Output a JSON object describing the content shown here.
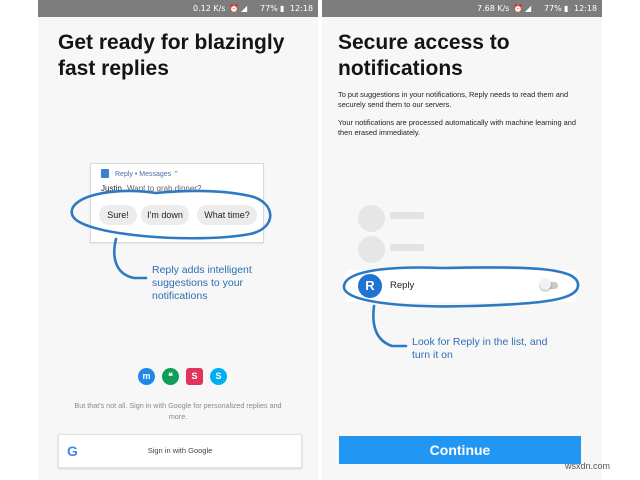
{
  "screen1": {
    "status": {
      "speed": "0.12 K/s",
      "battery": "77%",
      "time": "12:18"
    },
    "title": "Get ready for blazingly fast replies",
    "notification": {
      "app_label": "Reply • Messages ⌃",
      "sender": "Justin",
      "message": "Want to grab dinner?"
    },
    "suggestions": [
      "Sure!",
      "I'm down",
      "What time?"
    ],
    "caption": "Reply adds intelligent suggestions to your notifications",
    "apps": [
      {
        "name": "messenger-icon",
        "glyph": "m",
        "color": "#1e88e5"
      },
      {
        "name": "hangouts-icon",
        "glyph": "❝",
        "color": "#0f9d58"
      },
      {
        "name": "slack-icon",
        "glyph": "S",
        "color": "#e0345c"
      },
      {
        "name": "skype-icon",
        "glyph": "S",
        "color": "#00aff0"
      }
    ],
    "footnote": "But that's not all. Sign in with Google for personalized replies and more.",
    "google_button": "Sign in with Google",
    "google_glyph": "G"
  },
  "screen2": {
    "status": {
      "speed": "7.68 K/s",
      "battery": "77%",
      "time": "12:18"
    },
    "title": "Secure access to notifications",
    "para1": "To put suggestions in your notifications, Reply needs to read them and securely send them to our servers.",
    "para2": "Your notifications are processed automatically with machine learning and then erased immediately.",
    "app_row": {
      "name": "Reply",
      "logo": "R",
      "enabled": false
    },
    "caption": "Look for Reply in the list, and turn it on",
    "continue": "Continue"
  },
  "watermark": "wsxdn.com"
}
